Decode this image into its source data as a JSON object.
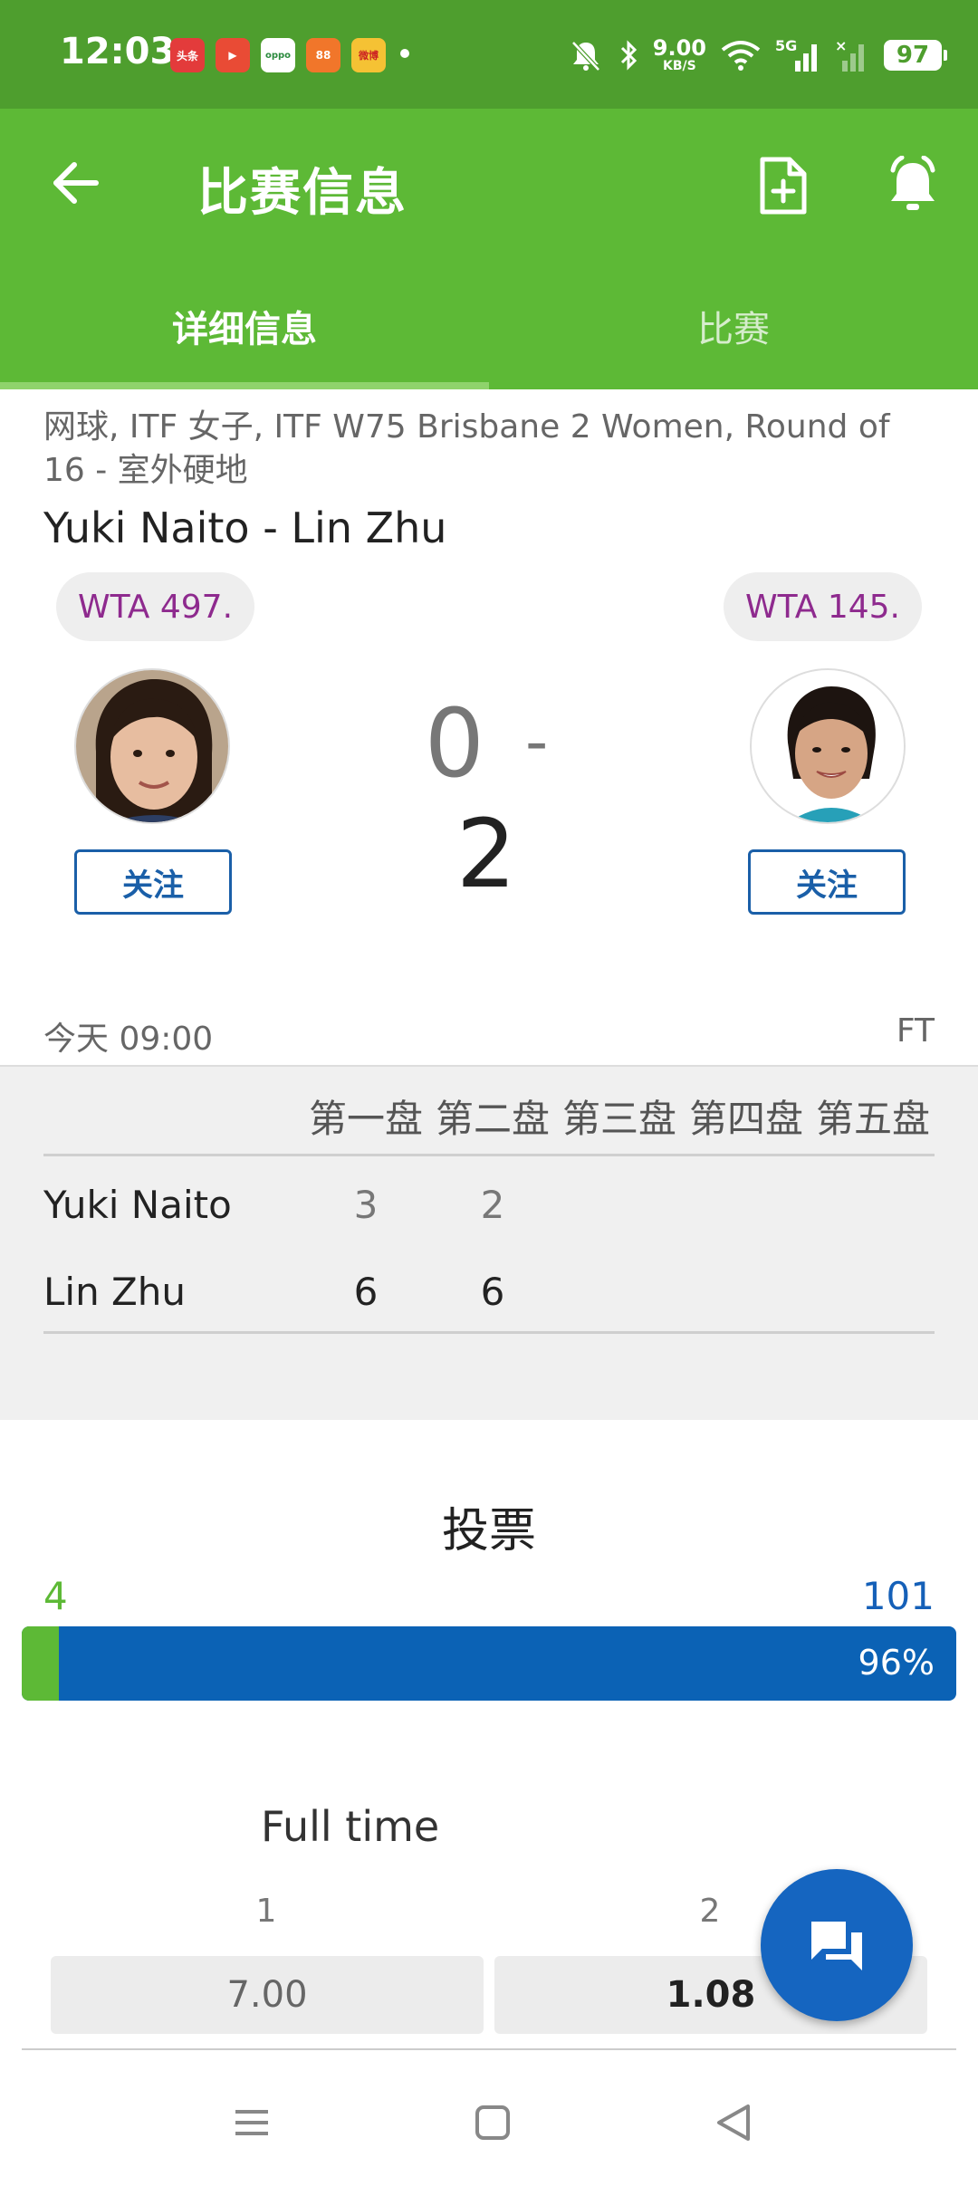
{
  "status_bar": {
    "time": "12:03",
    "apps": [
      {
        "name": "头条",
        "color": "#e33b3b"
      },
      {
        "name": "▶",
        "color": "#e94b35"
      },
      {
        "name": "oppo",
        "color": "#ffffff"
      },
      {
        "name": "88",
        "color": "#f1762a"
      },
      {
        "name": "微博",
        "color": "#f5c234"
      }
    ],
    "speed_value": "9.00",
    "speed_unit": "KB/S",
    "network": "5G",
    "battery": "97"
  },
  "app_bar": {
    "title": "比赛信息"
  },
  "tabs": [
    {
      "label": "详细信息",
      "active": true
    },
    {
      "label": "比赛",
      "active": false
    }
  ],
  "match": {
    "subtitle": "网球, ITF 女子, ITF W75 Brisbane 2 Women, Round of 16 - 室外硬地",
    "title": "Yuki Naito - Lin Zhu",
    "home": {
      "rank": "WTA 497.",
      "follow": "关注"
    },
    "away": {
      "rank": "WTA 145.",
      "follow": "关注"
    },
    "score_home": "0",
    "score_sep": "-",
    "score_away": "2",
    "start": "今天 09:00",
    "status": "FT"
  },
  "set_table": {
    "headers": [
      "第一盘",
      "第二盘",
      "第三盘",
      "第四盘",
      "第五盘"
    ],
    "rows": [
      {
        "player": "Yuki Naito",
        "sets": [
          "3",
          "2"
        ]
      },
      {
        "player": "Lin Zhu",
        "sets": [
          "6",
          "6"
        ]
      }
    ]
  },
  "vote": {
    "title": "投票",
    "home_votes": "4",
    "away_votes": "101",
    "away_percent_label": "96%",
    "home_share": 0.04
  },
  "odds": {
    "title": "Full time",
    "options": [
      {
        "label": "1",
        "value": "7.00"
      },
      {
        "label": "2",
        "value": "1.08"
      }
    ]
  },
  "colors": {
    "status_bar": "#4e9e2e",
    "app_bar": "#5db936",
    "accent_blue": "#1560b8",
    "rank_text": "#8e2a8e"
  },
  "icons": {
    "back": "arrow-left-icon",
    "add_doc": "add-document-icon",
    "alarm": "alarm-bell-icon",
    "chat": "chat-icon",
    "nav_menu": "menu-icon",
    "nav_home": "home-icon",
    "nav_back": "triangle-back-icon"
  }
}
